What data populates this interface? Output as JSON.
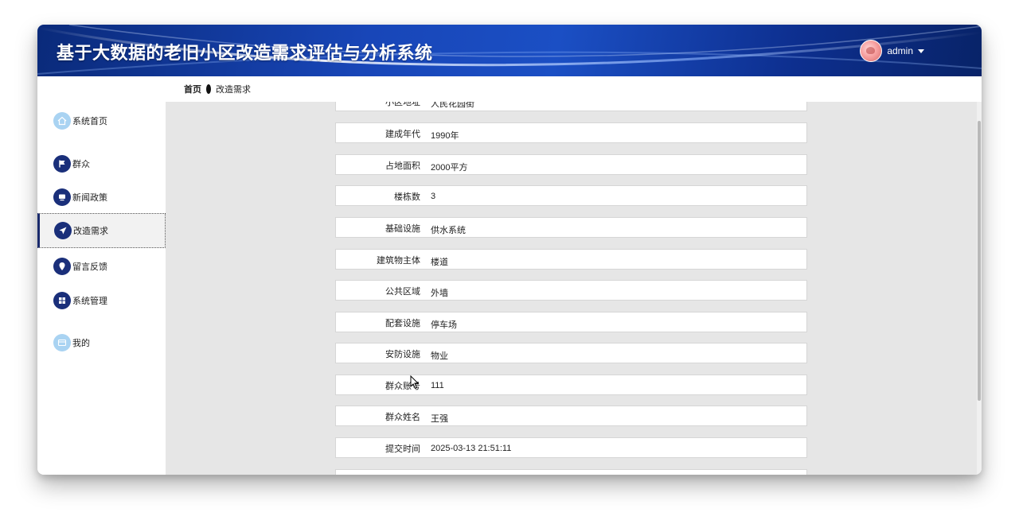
{
  "header": {
    "title": "基于大数据的老旧小区改造需求评估与分析系统",
    "user": "admin"
  },
  "breadcrumb": {
    "home": "首页",
    "current": "改造需求"
  },
  "sidebar": {
    "items": [
      {
        "label": "系统首页",
        "icon": "home-icon"
      },
      {
        "label": "群众",
        "icon": "flag-icon"
      },
      {
        "label": "新闻政策",
        "icon": "monitor-icon"
      },
      {
        "label": "改造需求",
        "icon": "send-icon",
        "active": true
      },
      {
        "label": "留言反馈",
        "icon": "pin-icon"
      },
      {
        "label": "系统管理",
        "icon": "grid-icon"
      },
      {
        "label": "我的",
        "icon": "card-icon"
      }
    ]
  },
  "form": {
    "partial_top": {
      "label": "小区地址",
      "value": "人民花园街"
    },
    "rows": [
      {
        "label": "建成年代",
        "value": "1990年"
      },
      {
        "label": "占地面积",
        "value": "2000平方"
      },
      {
        "label": "楼栋数",
        "value": "3"
      },
      {
        "label": "基础设施",
        "value": "供水系统"
      },
      {
        "label": "建筑物主体",
        "value": "楼道"
      },
      {
        "label": "公共区域",
        "value": "外墙"
      },
      {
        "label": "配套设施",
        "value": "停车场"
      },
      {
        "label": "安防设施",
        "value": "物业"
      },
      {
        "label": "群众账号",
        "value": "111"
      },
      {
        "label": "群众姓名",
        "value": "王强"
      },
      {
        "label": "提交时间",
        "value": "2025-03-13 21:51:11"
      }
    ]
  },
  "colors": {
    "header_primary": "#1846b8",
    "header_dark": "#082368",
    "nav_icon": "#1a2f7a",
    "nav_icon_light": "#a9d3f2",
    "content_bg": "#e6e6e6"
  }
}
